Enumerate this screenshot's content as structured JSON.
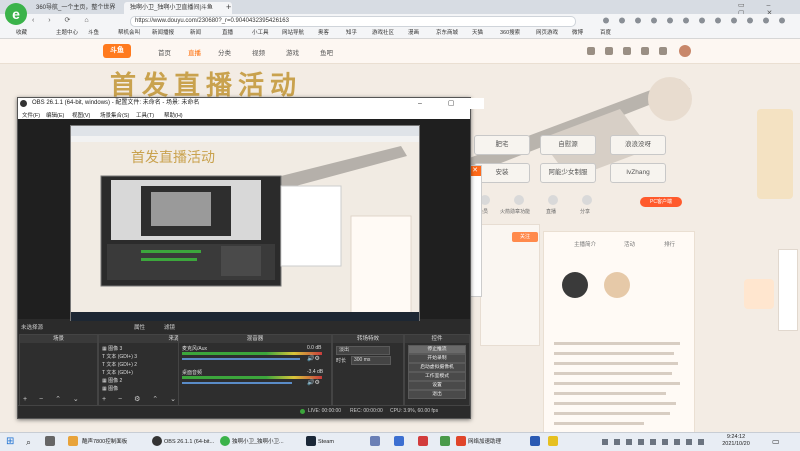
{
  "browser": {
    "tabs": [
      {
        "label": "360导航_一个主页，整个世界",
        "active": false
      },
      {
        "label": "独啊小卫_独啊小卫直播间|斗鱼",
        "active": true
      }
    ],
    "url": "https://www.douyu.com/230680?_r=0.9040432395426163",
    "bookmarks": [
      "收藏",
      "主题中心",
      "斗鱼",
      "帮机会叫",
      "新闻播报",
      "新闻",
      "直播",
      "小工具",
      "网站导航",
      "奥客",
      "知乎",
      "游戏社区",
      "漫画",
      "京东商城",
      "天猫",
      "360搜索",
      "网页游戏",
      "微博",
      "百度"
    ]
  },
  "site": {
    "logo": "斗鱼",
    "nav": [
      "首页",
      "直播",
      "分类",
      "视频",
      "游戏",
      "鱼吧"
    ],
    "banner_text": "首发直播活动",
    "tags": [
      "肥宅",
      "自慰源",
      "浪浪没呀",
      "安装",
      "阿能少女制服",
      "IvZhang"
    ],
    "side_labels": [
      "会员",
      "火箭勋章功能",
      "直播",
      "分享"
    ],
    "pc_badge": "PC客户端",
    "panel_tabs": [
      "主播简介",
      "活动",
      "排行"
    ],
    "fav_label": "关注"
  },
  "obs": {
    "title": "OBS 26.1.1 (64-bit, windows) - 配置文件: 未命名 - 场景: 未命名",
    "menu": [
      "文件(F)",
      "编辑(E)",
      "视图(V)",
      "场景集合(S)",
      "工具(T)",
      "帮助(H)"
    ],
    "scene_label": "未选择源",
    "toolbar_props": "属性",
    "toolbar_filters": "滤镜",
    "docks": {
      "scenes": "场景",
      "sources": "来源",
      "mixer": "混音器",
      "transitions": "转场特效",
      "controls": "控件"
    },
    "sources": [
      {
        "icon": "▦",
        "name": "图像 3"
      },
      {
        "icon": "T",
        "name": "文本 (GDI+) 3"
      },
      {
        "icon": "T",
        "name": "文本 (GDI+) 2"
      },
      {
        "icon": "T",
        "name": "文本 (GDI+)"
      },
      {
        "icon": "▦",
        "name": "图像 2"
      },
      {
        "icon": "▦",
        "name": "图像"
      }
    ],
    "mixer": [
      {
        "name": "麦克风/Aux",
        "db": "0.0 dB"
      },
      {
        "name": "桌面音频",
        "db": "-3.4 dB"
      }
    ],
    "transition": {
      "type": "淡出",
      "duration_label": "时长",
      "duration": "300 ms"
    },
    "controls": [
      "停止推流",
      "开始录制",
      "启动虚拟摄像机",
      "工作室模式",
      "设置",
      "退出"
    ],
    "status": {
      "live": "LIVE: 00:00:00",
      "rec": "REC: 00:00:00",
      "cpu": "CPU: 3.9%, 60.00 fps"
    }
  },
  "taskbar": {
    "apps": [
      "酷声7800控制面板",
      "OBS 26.1.1 (64-bit...",
      "独啊小卫_独啊小卫...",
      "Steam",
      "网络加速助理"
    ],
    "time": "9:24:12",
    "date": "2021/10/20"
  }
}
